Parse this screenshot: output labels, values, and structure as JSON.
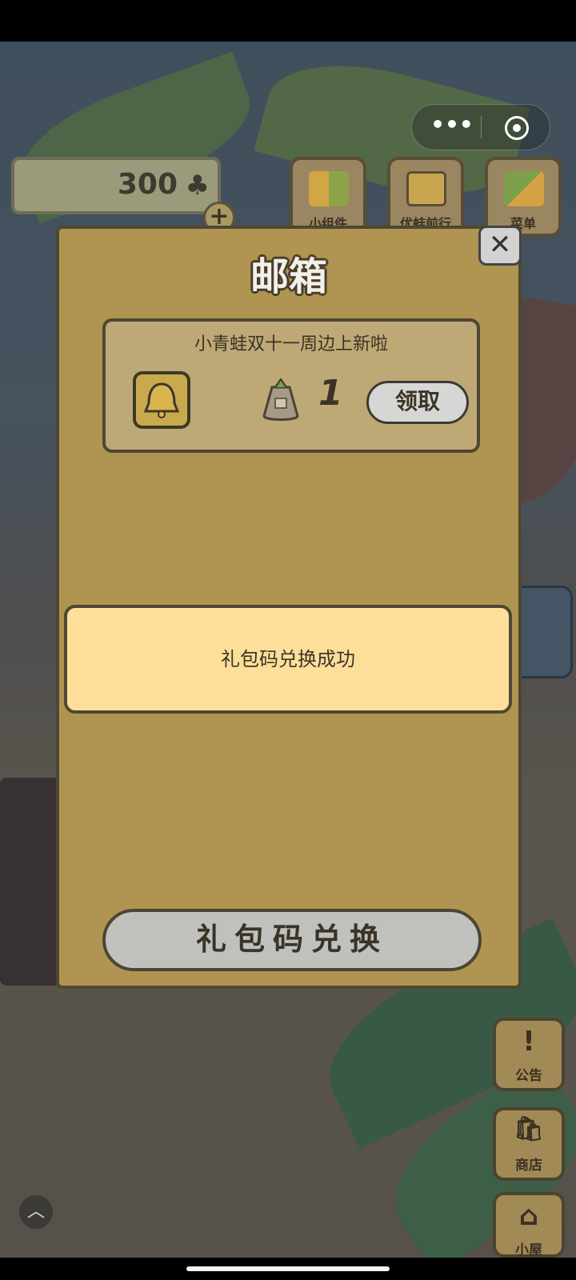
{
  "mini_program_capsule": {
    "more_icon": "more-dots-icon",
    "close_icon": "target-circle-icon",
    "more_glyph": "•••"
  },
  "currency": {
    "amount": "300",
    "icon": "clover-icon",
    "clover_glyph": "♣",
    "add_glyph": "+"
  },
  "top_buttons": [
    {
      "label": "小组件",
      "icon": "widget-icon"
    },
    {
      "label": "优蛙前行",
      "icon": "album-icon"
    },
    {
      "label": "菜单",
      "icon": "menu-icon"
    }
  ],
  "mailbox": {
    "title": "邮箱",
    "close_glyph": "✕",
    "mail": {
      "subject": "小青蛙双十一周边上新啦",
      "attachment_icon": "bell-icon",
      "reward_icon": "seed-bag-icon",
      "reward_count": "1",
      "claim_label": "领取"
    },
    "redeem_label": "礼包码兑换"
  },
  "toast": {
    "message": "礼包码兑换成功"
  },
  "side_buttons": [
    {
      "label": "公告",
      "icon": "exclamation-icon",
      "glyph": "!"
    },
    {
      "label": "商店",
      "icon": "shop-bags-icon",
      "glyph": "🛍"
    },
    {
      "label": "小屋",
      "icon": "house-icon",
      "glyph": "⌂"
    }
  ],
  "scroll_up_glyph": "︿"
}
